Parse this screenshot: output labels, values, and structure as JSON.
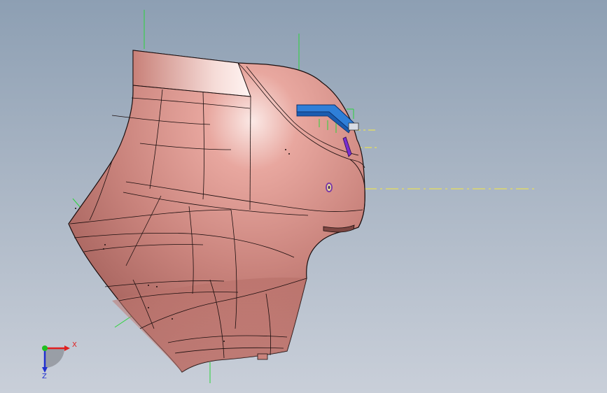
{
  "viewport": {
    "background_top": "#8d9fb3",
    "background_bottom": "#c9cfd9"
  },
  "part": {
    "body_color": "#c9837c",
    "highlight_color": "#f4d8d4",
    "shadow_color": "#9c5a55",
    "edge_color": "#1a0d0d"
  },
  "features": {
    "bracket_color": "#2f7fd8",
    "clip_color": "#7a2fd0",
    "hole_color": "#7b3aa8"
  },
  "reference_geometry": {
    "axis_color": "#e8e05a",
    "plane_color": "#2ad43a"
  },
  "triad": {
    "x_label": "X",
    "z_label": "Z",
    "x_color": "#e02020",
    "y_color": "#20c020",
    "z_color": "#2030d0"
  }
}
